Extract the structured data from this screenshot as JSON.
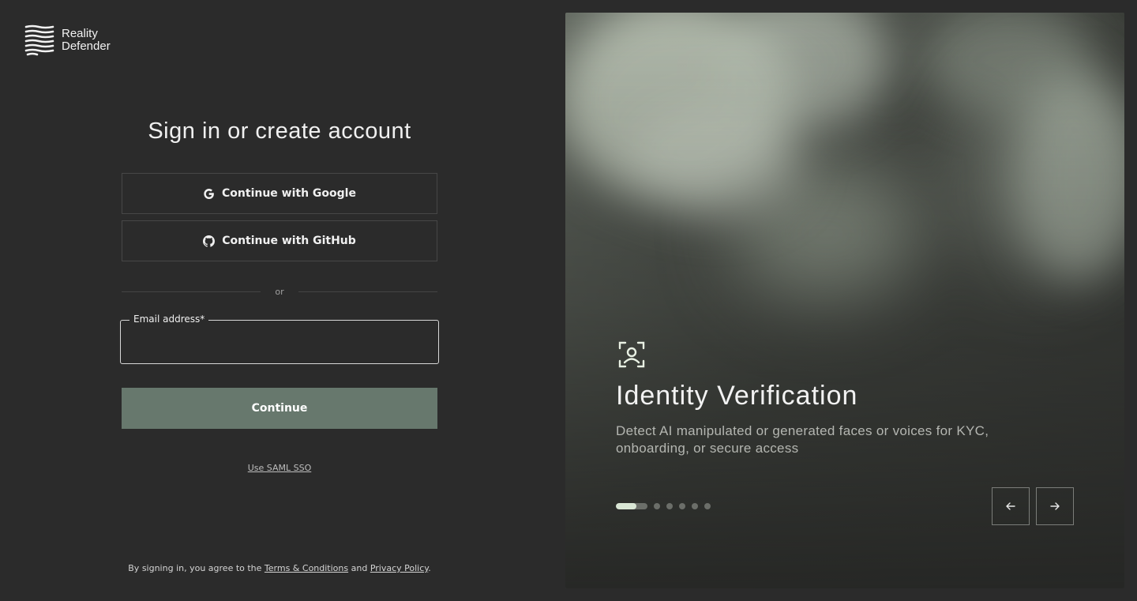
{
  "brand": {
    "name_line1": "Reality",
    "name_line2": "Defender"
  },
  "signin": {
    "heading": "Sign in or create account",
    "google_label": "Continue with Google",
    "github_label": "Continue with GitHub",
    "divider_text": "or",
    "email_label": "Email address*",
    "email_value": "",
    "continue_label": "Continue",
    "saml_label": "Use SAML SSO"
  },
  "legal": {
    "prefix": "By signing in, you agree to the ",
    "terms_label": "Terms & Conditions",
    "middle": " and ",
    "privacy_label": "Privacy Policy",
    "suffix": "."
  },
  "carousel": {
    "icon": "face-scan-icon",
    "title": "Identity Verification",
    "description": "Detect AI manipulated or generated faces or voices for KYC, onboarding, or secure access",
    "slide_count": 6,
    "active_index": 0,
    "active_progress": 0.65,
    "prev_icon": "arrow-left-icon",
    "next_icon": "arrow-right-icon"
  },
  "colors": {
    "page_bg": "#2b2b2b",
    "continue_bg": "#67786d",
    "active_dot": "#d9e6d4"
  }
}
